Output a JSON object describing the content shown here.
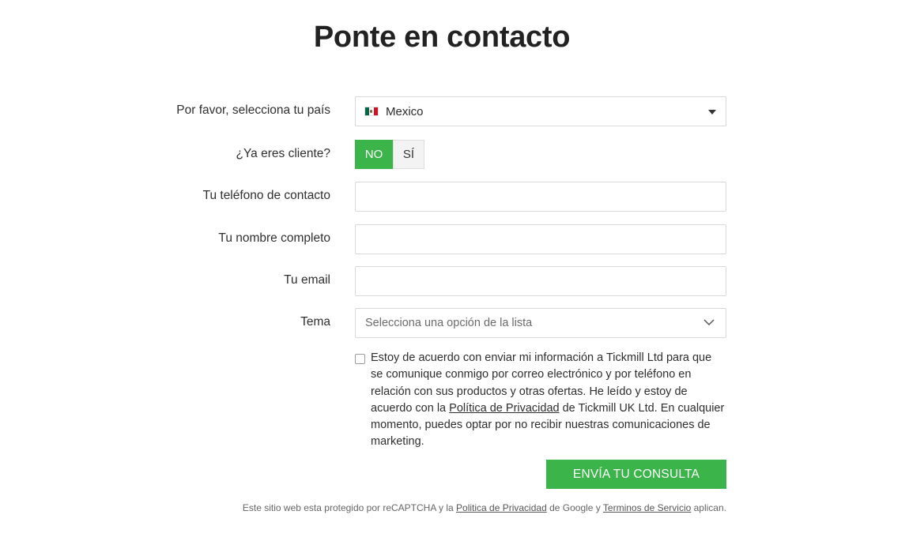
{
  "page": {
    "title": "Ponte en contacto"
  },
  "form": {
    "country": {
      "label": "Por favor, selecciona tu país",
      "value": "Mexico",
      "flag_icon": "mexico-flag-icon"
    },
    "client": {
      "label": "¿Ya eres cliente?",
      "options": [
        "NO",
        "SÍ"
      ],
      "selected": "NO"
    },
    "phone": {
      "label": "Tu teléfono de contacto",
      "value": ""
    },
    "name": {
      "label": "Tu nombre completo",
      "value": ""
    },
    "email": {
      "label": "Tu email",
      "value": ""
    },
    "topic": {
      "label": "Tema",
      "placeholder": "Selecciona una opción de la lista"
    },
    "consent": {
      "checked": false,
      "text_before": "Estoy de acuerdo con enviar mi información a Tickmill Ltd para que se comunique conmigo por correo electrónico y por teléfono en relación con sus productos y otras ofertas. He leído y estoy de acuerdo con la ",
      "link": "Política de Privacidad",
      "text_after": " de Tickmill UK Ltd. En cualquier momento, puedes optar por no recibir nuestras comunicaciones de marketing."
    },
    "submit_label": "ENVÍA TU CONSULTA"
  },
  "footer": {
    "t1": "Este sitio web esta protegido por reCAPTCHA y la ",
    "link1": "Politica de Privacidad",
    "t2": " de Google y ",
    "link2": "Terminos de Servicio",
    "t3": " aplican."
  },
  "colors": {
    "accent": "#3bb54a",
    "border": "#d9d9d9",
    "toggle_inactive": "#f3f3f3"
  }
}
